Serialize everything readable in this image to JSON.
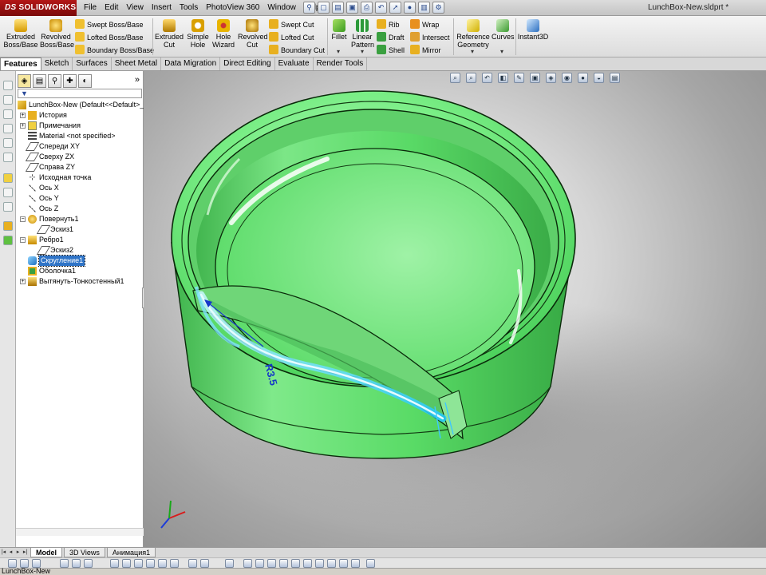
{
  "app": {
    "logo": "SOLIDWORKS",
    "logo_prefix": "DS",
    "doc_title": "LunchBox-New.sldprt *"
  },
  "menu": [
    "File",
    "Edit",
    "View",
    "Insert",
    "Tools",
    "PhotoView 360",
    "Window",
    "Help"
  ],
  "commands": {
    "extruded_boss": "Extruded Boss/Base",
    "revolved_boss": "Revolved Boss/Base",
    "swept_boss": "Swept Boss/Base",
    "lofted_boss": "Lofted Boss/Base",
    "boundary_boss": "Boundary Boss/Base",
    "extruded_cut": "Extruded Cut",
    "simple_hole": "Simple Hole",
    "hole_wizard": "Hole Wizard",
    "revolved_cut": "Revolved Cut",
    "swept_cut": "Swept Cut",
    "lofted_cut": "Lofted Cut",
    "boundary_cut": "Boundary Cut",
    "fillet": "Fillet",
    "linear_pattern": "Linear Pattern",
    "rib": "Rib",
    "draft": "Draft",
    "shell": "Shell",
    "wrap": "Wrap",
    "intersect": "Intersect",
    "mirror": "Mirror",
    "reference_geometry": "Reference Geometry",
    "curves": "Curves",
    "instant3d": "Instant3D"
  },
  "tabs": [
    "Features",
    "Sketch",
    "Surfaces",
    "Sheet Metal",
    "Data Migration",
    "Direct Editing",
    "Evaluate",
    "Render Tools"
  ],
  "active_tab": "Features",
  "tree": {
    "root": "LunchBox-New  (Default<<Default>_V",
    "items": [
      {
        "label": "История"
      },
      {
        "label": "Примечания"
      },
      {
        "label": "Material <not specified>"
      },
      {
        "label": "Спереди XY"
      },
      {
        "label": "Сверху ZX"
      },
      {
        "label": "Справа ZY"
      },
      {
        "label": "Исходная точка"
      },
      {
        "label": "Ось X"
      },
      {
        "label": "Ось Y"
      },
      {
        "label": "Ось Z"
      },
      {
        "label": "Повернуть1"
      },
      {
        "label": "Эскиз1"
      },
      {
        "label": "Ребро1"
      },
      {
        "label": "Эскиз2"
      },
      {
        "label": "Скругление1"
      },
      {
        "label": "Оболочка1"
      },
      {
        "label": "Вытянуть-Тонкостенный1"
      }
    ]
  },
  "viewport": {
    "dimension_label": "R3.5",
    "model_color": "#5ee872",
    "highlight_color": "#33d6ff"
  },
  "bottom_tabs": [
    "Model",
    "3D Views",
    "Анимация1"
  ],
  "status": {
    "text": "LunchBox-New"
  }
}
